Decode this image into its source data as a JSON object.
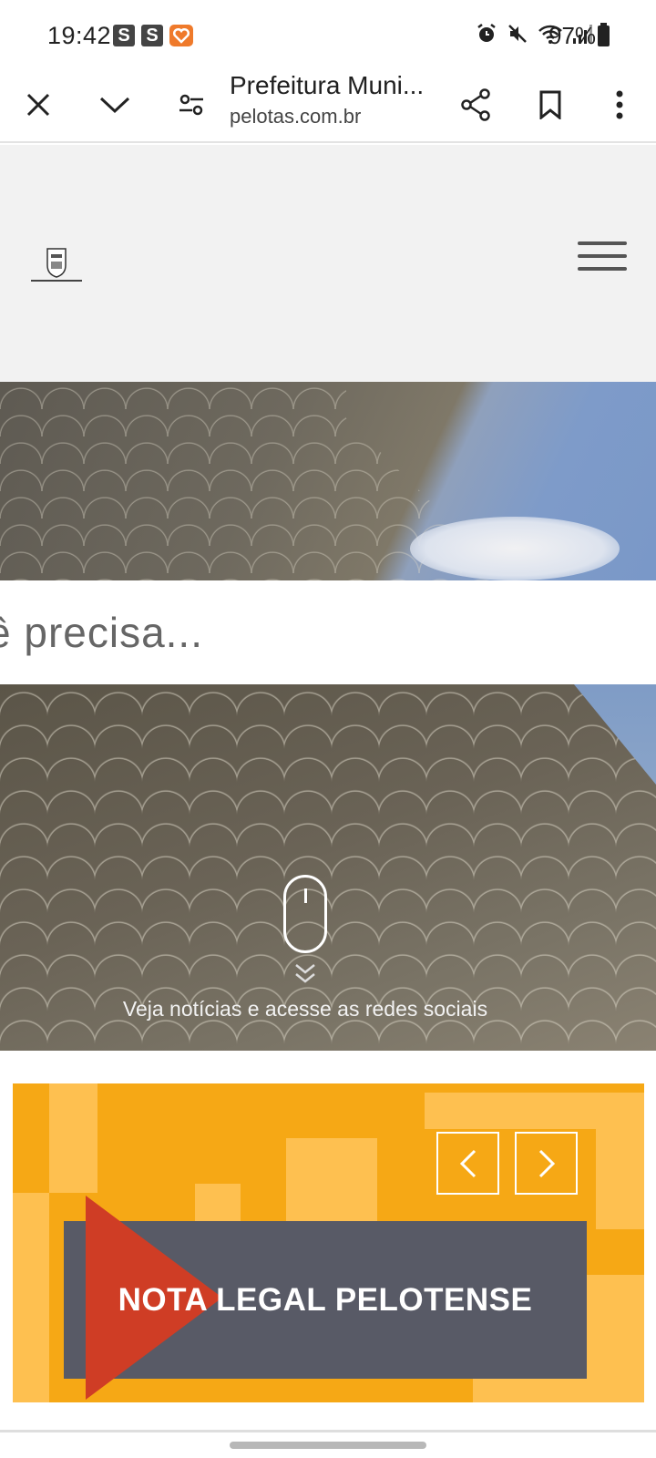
{
  "status_bar": {
    "time": "19:42",
    "badge_1": "S",
    "badge_2": "S",
    "battery": "97%"
  },
  "browser": {
    "page_title": "Prefeitura Muni...",
    "url": "pelotas.com.br",
    "icons": [
      "close-icon",
      "chevron-down-icon",
      "tune-icon",
      "share-icon",
      "bookmark-icon",
      "more-vert-icon"
    ]
  },
  "site": {
    "search_text": "ê precisa...",
    "scroll_caption": "Veja notícias e acesse as redes sociais",
    "banner_title": "NOTA LEGAL PELOTENSE"
  },
  "colors": {
    "banner_bg": "#f6a815",
    "banner_card": "#585a66",
    "banner_arrow": "#cf3d25",
    "header_bg": "#f2f2f2"
  }
}
